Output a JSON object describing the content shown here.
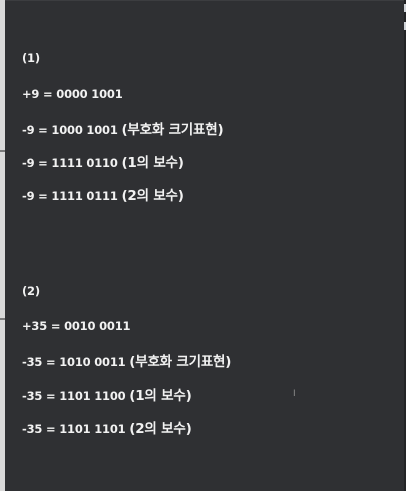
{
  "section1": {
    "heading": "(1)",
    "lines": [
      {
        "expr": "+9 = 0000 1001",
        "note": ""
      },
      {
        "expr": "-9 = 1000 1001 ",
        "note": "(부호화 크기표현)"
      },
      {
        "expr": "-9 = 1111 0110 ",
        "note": "(1의 보수)"
      },
      {
        "expr": "-9 = 1111 0111 ",
        "note": "(2의 보수)"
      }
    ]
  },
  "section2": {
    "heading": "(2)",
    "lines": [
      {
        "expr": "+35 = 0010 0011",
        "note": ""
      },
      {
        "expr": "-35 = 1010 0011 ",
        "note": "(부호화 크기표현)"
      },
      {
        "expr": "-35 = 1101 1100 ",
        "note": "(1의 보수)"
      },
      {
        "expr": "-35 = 1101 1101 ",
        "note": "(2의 보수)"
      }
    ]
  },
  "cursor_glyph": "I"
}
